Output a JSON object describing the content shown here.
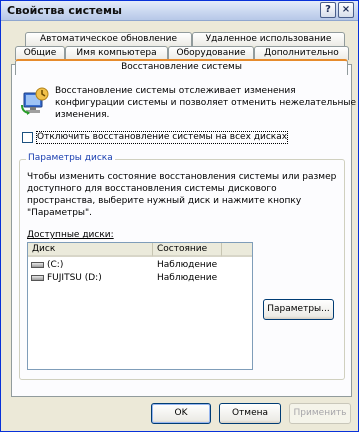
{
  "window": {
    "title": "Свойства системы"
  },
  "titlebar_buttons": {
    "help": "?",
    "close": "×"
  },
  "tabs_row1": [
    {
      "label": "Автоматическое обновление"
    },
    {
      "label": "Удаленное использование"
    }
  ],
  "tabs_row2": [
    {
      "label": "Общие"
    },
    {
      "label": "Имя компьютера"
    },
    {
      "label": "Оборудование"
    },
    {
      "label": "Дополнительно"
    }
  ],
  "active_tab": {
    "label": "Восстановление системы"
  },
  "intro": {
    "line1": "Восстановление системы отслеживает изменения",
    "line2": "конфигурации системы и позволяет отменить нежелательные",
    "line3": "изменения."
  },
  "disable_checkbox": {
    "label": "Отключить восстановление системы на всех дисках",
    "checked": false
  },
  "disk_settings": {
    "legend": "Параметры диска",
    "desc1": "Чтобы изменить состояние восстановления системы или размер",
    "desc2": "доступного для восстановления системы дискового",
    "desc3": "пространства, выберите нужный диск и нажмите кнопку",
    "desc4": "\"Параметры\"."
  },
  "available_disks": {
    "label": "Доступные диски:",
    "columns": [
      "Диск",
      "Состояние"
    ],
    "rows": [
      {
        "disk": "(C:)",
        "status": "Наблюдение"
      },
      {
        "disk": "FUJITSU (D:)",
        "status": "Наблюдение"
      }
    ]
  },
  "params_button": {
    "label": "Параметры..."
  },
  "footer": {
    "ok": "OK",
    "cancel": "Отмена",
    "apply": "Применить"
  }
}
